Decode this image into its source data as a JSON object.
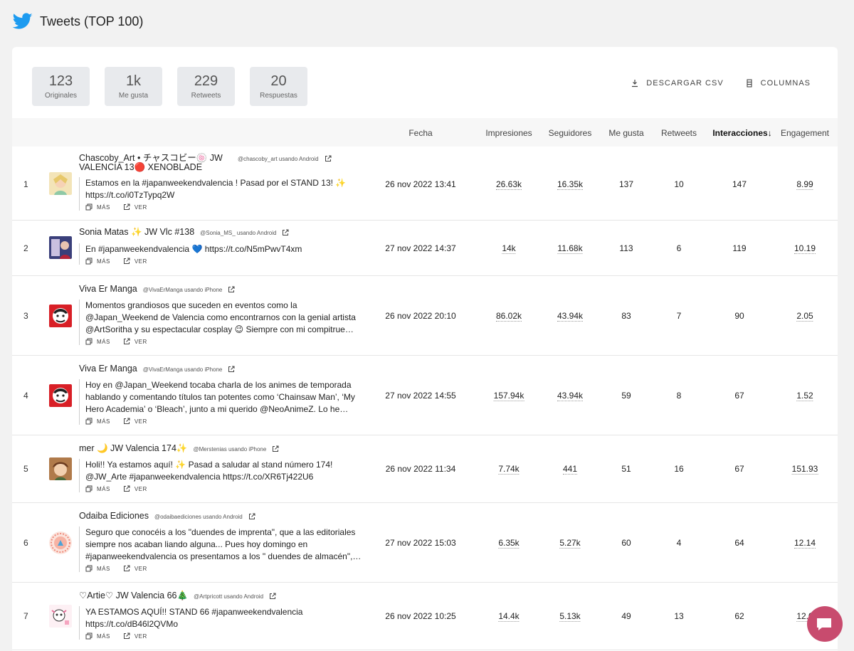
{
  "header": {
    "title": "Tweets (TOP 100)"
  },
  "stats": [
    {
      "value": "123",
      "label": "Originales"
    },
    {
      "value": "1k",
      "label": "Me gusta"
    },
    {
      "value": "229",
      "label": "Retweets"
    },
    {
      "value": "20",
      "label": "Respuestas"
    }
  ],
  "actions": {
    "download": "DESCARGAR CSV",
    "columns": "COLUMNAS"
  },
  "columns": {
    "fecha": "Fecha",
    "impresiones": "Impresiones",
    "seguidores": "Seguidores",
    "megusta": "Me gusta",
    "retweets": "Retweets",
    "interacciones": "Interacciones",
    "interacciones_arrow": "↓",
    "engagement": "Engagement"
  },
  "labels": {
    "mas": "MÁS",
    "ver": "VER"
  },
  "rows": [
    {
      "rank": "1",
      "name": "Chascoby_Art • チャスコビー🍥 JW VALENCIA 13🔴 XENOBLADE",
      "handle": "@chascoby_art usando Android",
      "text": "Estamos en la #japanweekendvalencia ! Pasad por el STAND 13! ✨ https://t.co/i0TzTypq2W",
      "fecha": "26 nov 2022 13:41",
      "impresiones": "26.63k",
      "seguidores": "16.35k",
      "megusta": "137",
      "retweets": "10",
      "interacciones": "147",
      "engagement": "8.99"
    },
    {
      "rank": "2",
      "name": "Sonia Matas ✨ JW Vlc #138",
      "handle": "@Sonia_MS_ usando Android",
      "text": "En #japanweekendvalencia 💙 https://t.co/N5mPwvT4xm",
      "fecha": "27 nov 2022 14:37",
      "impresiones": "14k",
      "seguidores": "11.68k",
      "megusta": "113",
      "retweets": "6",
      "interacciones": "119",
      "engagement": "10.19"
    },
    {
      "rank": "3",
      "name": "Viva Er Manga",
      "handle": "@VivaErManga usando iPhone",
      "text": "Momentos grandiosos que suceden en eventos como la @Japan_Weekend de Valencia como encontrarnos con la genial artista @ArtSoritha y su espectacular cosplay 😉 Siempre con mi compitrue…",
      "fecha": "26 nov 2022 20:10",
      "impresiones": "86.02k",
      "seguidores": "43.94k",
      "megusta": "83",
      "retweets": "7",
      "interacciones": "90",
      "engagement": "2.05"
    },
    {
      "rank": "4",
      "name": "Viva Er Manga",
      "handle": "@VivaErManga usando iPhone",
      "text": "Hoy en @Japan_Weekend tocaba charla de los animes de temporada hablando y comentando títulos tan potentes como ‘Chainsaw Man’, ‘My Hero Academia’ o ‘Bleach’, junto a mi querido @NeoAnimeZ. Lo he…",
      "fecha": "27 nov 2022 14:55",
      "impresiones": "157.94k",
      "seguidores": "43.94k",
      "megusta": "59",
      "retweets": "8",
      "interacciones": "67",
      "engagement": "1.52"
    },
    {
      "rank": "5",
      "name": "mer 🌙 JW Valencia 174✨",
      "handle": "@Merstenias usando iPhone",
      "text": "Holi!! Ya estamos aquí! ✨ Pasad a saludar al stand número 174! @JW_Arte #japanweekendvalencia https://t.co/XR6Tj422U6",
      "fecha": "26 nov 2022 11:34",
      "impresiones": "7.74k",
      "seguidores": "441",
      "megusta": "51",
      "retweets": "16",
      "interacciones": "67",
      "engagement": "151.93"
    },
    {
      "rank": "6",
      "name": "Odaiba Ediciones",
      "handle": "@odaibaediciones usando Android",
      "text": "Seguro que conocéis a los \"duendes de imprenta\", que a las editoriales siempre nos acaban liando alguna... Pues hoy domingo en #japanweekendvalencia os presentamos a los \" duendes de almacén\",…",
      "fecha": "27 nov 2022 15:03",
      "impresiones": "6.35k",
      "seguidores": "5.27k",
      "megusta": "60",
      "retweets": "4",
      "interacciones": "64",
      "engagement": "12.14"
    },
    {
      "rank": "7",
      "name": "♡Artie♡ JW Valencia 66🎄",
      "handle": "@Artpricott usando Android",
      "text": "YA ESTAMOS AQUÍ!! STAND 66 #japanweekendvalencia https://t.co/dB46l2QVMo",
      "fecha": "26 nov 2022 10:25",
      "impresiones": "14.4k",
      "seguidores": "5.13k",
      "megusta": "49",
      "retweets": "13",
      "interacciones": "62",
      "engagement": "12.0"
    }
  ],
  "colors": {
    "twitter": "#1d9bf0",
    "chat": "#c84b6e"
  },
  "icons": {
    "brand": "twitter-bird-icon",
    "chat": "chat-icon"
  }
}
